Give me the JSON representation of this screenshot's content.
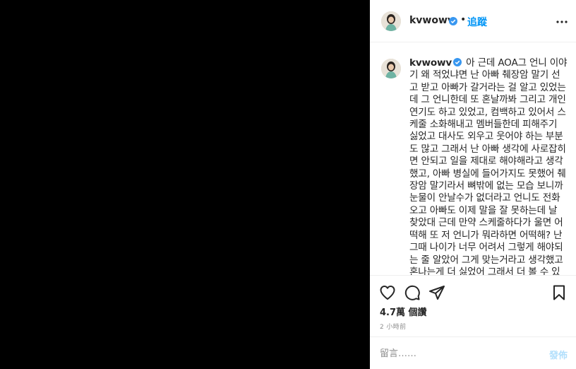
{
  "header": {
    "username": "kvwowv",
    "dot": "•",
    "follow_label": "追蹤"
  },
  "caption": {
    "username": "kvwowv",
    "text": "아 근데 AOA그 언니 이야기 왜 적었냐면 난 아빠 췌장암 말기 선고 받고 아빠가 갈거라는 걸 알고 있었는데 그 언니한데 또 혼날까봐 그리고 개인 연기도 하고 있었고, 컴백하고 있어서 스케줄 소화해내고 멤버들한데 피해주기 싫었고 대사도 외우고 웃어야 하는 부분도 많고 그래서 난 아빠 생각에 사로잡히면 안되고 일을 제대로 해야해라고 생각했고, 아빠 병실에 들어가지도 못했어 췌장암 말기라서 뼈밖에 없는 모습 보니까 눈물이 안날수가 없더라고 언니도 전화오고 아빠도 이제 말을 잘 못하는데 날 찾았대 근데 만약 스케줄하다가 울면 어떡해 또 저 언니가 뭐라하면 어떡해? 난 그때 나이가 너무 어려서 그렇게 해야되는 줄 알았어 그게 맞는거라고 생각했고 혼나는게 더 싫었어 그래서 더 볼 수 있었는데 못 보고 그렇게 아빠 눈 감았을때 삐 소리 듣고 보고"
  },
  "stats": {
    "likes": "4.7萬 個讚",
    "time": "2 小時前"
  },
  "comment_box": {
    "placeholder": "留言……",
    "post_label": "發佈"
  },
  "colors": {
    "accent": "#0095f6",
    "verified": "#3897f0",
    "post_disabled": "#b2dffc"
  },
  "icons": [
    "more-options-icon",
    "verified-badge-icon",
    "heart-icon",
    "comment-icon",
    "share-icon",
    "bookmark-icon"
  ]
}
